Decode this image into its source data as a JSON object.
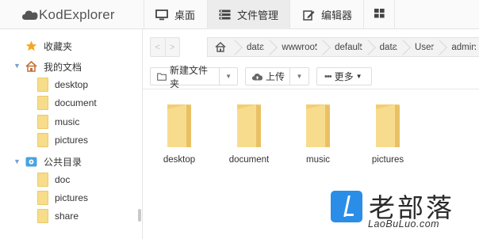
{
  "app": {
    "title": "KodExplorer"
  },
  "nav": {
    "tabs": [
      {
        "label": "桌面",
        "icon": "monitor-icon"
      },
      {
        "label": "文件管理",
        "icon": "server-icon",
        "active": true
      },
      {
        "label": "编辑器",
        "icon": "edit-icon"
      },
      {
        "label": "",
        "icon": "grid-icon"
      }
    ]
  },
  "sidebar": {
    "favorites": {
      "label": "收藏夹",
      "icon": "star-icon"
    },
    "my_docs": {
      "label": "我的文档",
      "icon": "home-icon",
      "children": [
        "desktop",
        "document",
        "music",
        "pictures"
      ]
    },
    "public": {
      "label": "公共目录",
      "icon": "drive-icon",
      "children": [
        "doc",
        "pictures",
        "share"
      ]
    }
  },
  "address": {
    "back_label": "<",
    "forward_label": ">",
    "crumbs": [
      "data",
      "wwwroot",
      "default",
      "data",
      "User",
      "admin"
    ]
  },
  "toolbar": {
    "new_folder": "新建文件夹",
    "upload": "上传",
    "more": "更多"
  },
  "files": [
    "desktop",
    "document",
    "music",
    "pictures"
  ],
  "watermark": {
    "cn": "老部落",
    "en": "LaoBuLuo.com"
  },
  "colors": {
    "folder": "#f7dc8a",
    "accent": "#2a8ee8",
    "star": "#f5a623"
  }
}
